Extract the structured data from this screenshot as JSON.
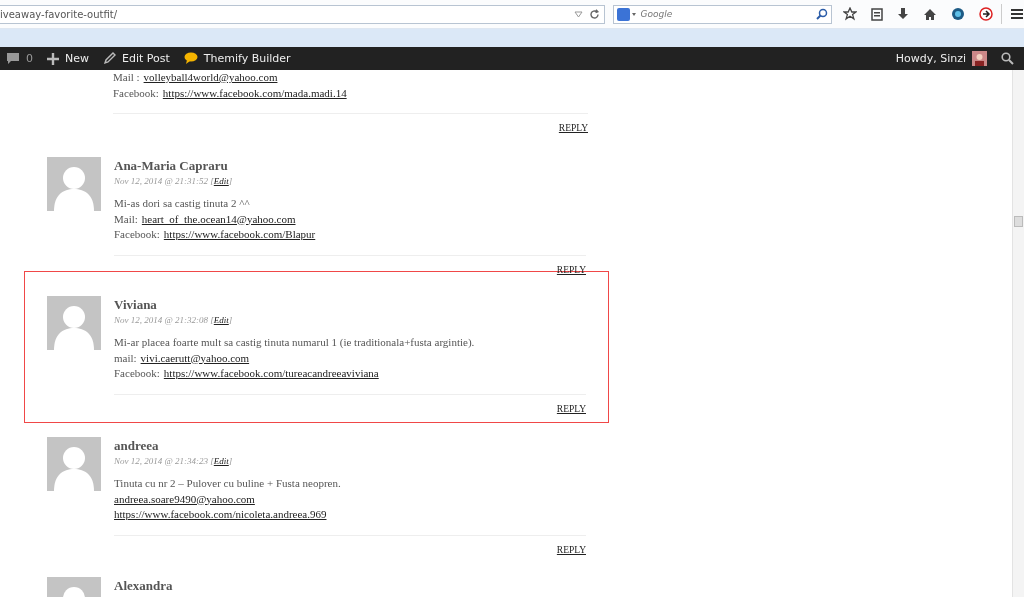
{
  "browser": {
    "url": "iveaway-favorite-outfit/",
    "search_placeholder": "Google"
  },
  "admin_bar": {
    "comments_count": "0",
    "new": "New",
    "edit": "Edit Post",
    "builder": "Themify Builder",
    "greeting": "Howdy, Sinzi"
  },
  "partial_comment": {
    "lines": [
      {
        "text": "Mail :",
        "link": "volleyball4world@yahoo.com"
      },
      {
        "text": "Facebook:",
        "link": "https://www.facebook.com/mada.madi.14"
      }
    ],
    "reply": "REPLY"
  },
  "comments": [
    {
      "author": "Ana-Maria Capraru",
      "date": "Nov 12, 2014 @ 21:31:52 [",
      "edit": "Edit",
      "date_end": "]",
      "highlighted": false,
      "reply": "REPLY",
      "lines": [
        {
          "text": "Mi-as dori sa castig tinuta 2 ^^"
        },
        {
          "text": "Mail:",
          "link": "heart_of_the.ocean14@yahoo.com"
        },
        {
          "text": "Facebook:",
          "link": "https://www.facebook.com/Blapur"
        }
      ]
    },
    {
      "author": "Viviana",
      "date": "Nov 12, 2014 @ 21:32:08 [",
      "edit": "Edit",
      "date_end": "]",
      "highlighted": true,
      "reply": "REPLY",
      "lines": [
        {
          "text": "Mi-ar placea foarte mult sa castig tinuta numarul 1 (ie traditionala+fusta argintie)."
        },
        {
          "text": "mail:",
          "link": "vivi.caerutt@yahoo.com"
        },
        {
          "text": "Facebook:",
          "link": "https://www.facebook.com/tureacandreeaviviana"
        }
      ]
    },
    {
      "author": "andreea",
      "date": "Nov 12, 2014 @ 21:34:23 [",
      "edit": "Edit",
      "date_end": "]",
      "highlighted": false,
      "reply": "REPLY",
      "lines": [
        {
          "text": "Tinuta cu nr 2 – Pulover cu buline + Fusta neopren."
        },
        {
          "link": "andreea.soare9490@yahoo.com"
        },
        {
          "link": "https://www.facebook.com/nicoleta.andreea.969"
        }
      ]
    },
    {
      "author": "Alexandra",
      "highlighted": false
    }
  ]
}
